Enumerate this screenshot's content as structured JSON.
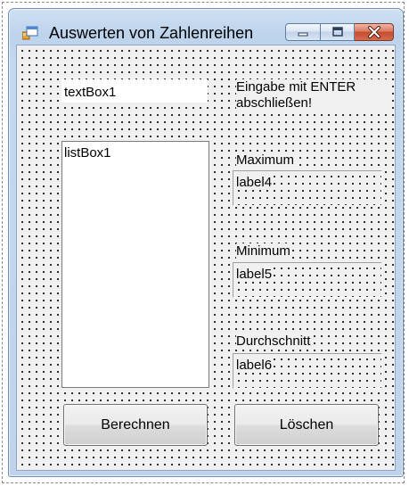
{
  "window": {
    "title": "Auswerten von Zahlenreihen",
    "icon": "windows-form-icon"
  },
  "textbox": {
    "value": "textBox1"
  },
  "hint": {
    "line1": "Eingabe mit ENTER",
    "line2": "abschließen!"
  },
  "listbox": {
    "items": [
      "listBox1"
    ]
  },
  "maximum": {
    "caption": "Maximum",
    "value": "label4"
  },
  "minimum": {
    "caption": "Minimum",
    "value": "label5"
  },
  "average": {
    "caption": "Durchschnitt",
    "value": "label6"
  },
  "buttons": {
    "calculate": "Berechnen",
    "clear": "Löschen"
  },
  "colors": {
    "titlebar": "#bcd3ec",
    "close_button": "#c64c32",
    "client_background": "#f0f0f0"
  }
}
